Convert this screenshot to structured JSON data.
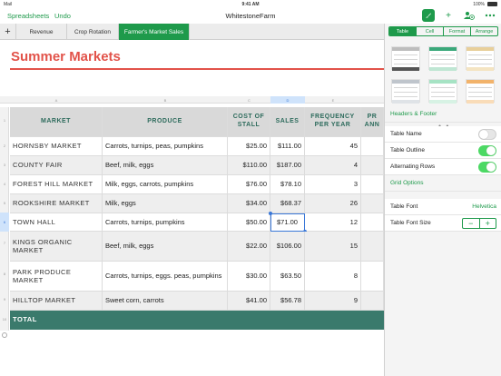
{
  "status_bar": {
    "carrier": "Mail",
    "wifi_icon": "wifi-icon",
    "time": "9:41 AM",
    "battery_pct": "100%"
  },
  "toolbar": {
    "spreadsheets_label": "Spreadsheets",
    "undo_label": "Undo",
    "doc_title": "WhitestoneFarm",
    "icons": [
      "paintbrush-icon",
      "plus-icon",
      "collaborate-icon",
      "more-icon"
    ],
    "accent": "#1e9a4b"
  },
  "sheet_tabs": {
    "add_label": "+",
    "tabs": [
      {
        "label": "Revenue",
        "active": false
      },
      {
        "label": "Crop Rotation",
        "active": false
      },
      {
        "label": "Farmer's Market Sales",
        "active": true
      }
    ]
  },
  "sheet": {
    "title": "Summer Markets",
    "title_color": "#e2534a",
    "column_letters": [
      "A",
      "B",
      "C",
      "D",
      "E"
    ],
    "selected_column": "D",
    "row_numbers": [
      "1",
      "2",
      "3",
      "4",
      "5",
      "6",
      "7",
      "8",
      "9",
      "10"
    ],
    "selected_row": "6",
    "headers": [
      "MARKET",
      "PRODUCE",
      "COST OF STALL",
      "SALES",
      "FREQUENCY PER YEAR",
      "PR ANN"
    ],
    "rows": [
      {
        "market": "HORNSBY MARKET",
        "produce": "Carrots, turnips, peas, pumpkins",
        "cost": "$25.00",
        "sales": "$111.00",
        "freq": "45"
      },
      {
        "market": "COUNTY FAIR",
        "produce": "Beef, milk, eggs",
        "cost": "$110.00",
        "sales": "$187.00",
        "freq": "4"
      },
      {
        "market": "FOREST HILL MARKET",
        "produce": "Milk, eggs, carrots, pumpkins",
        "cost": "$76.00",
        "sales": "$78.10",
        "freq": "3"
      },
      {
        "market": "ROOKSHIRE MARKET",
        "produce": "Milk, eggs",
        "cost": "$34.00",
        "sales": "$68.37",
        "freq": "26"
      },
      {
        "market": "TOWN HALL",
        "produce": "Carrots, turnips, pumpkins",
        "cost": "$50.00",
        "sales": "$71.00",
        "freq": "12"
      },
      {
        "market": "KINGS ORGANIC MARKET",
        "produce": "Beef, milk, eggs",
        "cost": "$22.00",
        "sales": "$106.00",
        "freq": "15"
      },
      {
        "market": "PARK PRODUCE MARKET",
        "produce": "Carrots, turnips, eggs. peas, pumpkins",
        "cost": "$30.00",
        "sales": "$63.50",
        "freq": "8"
      },
      {
        "market": "HILLTOP MARKET",
        "produce": "Sweet corn, carrots",
        "cost": "$41.00",
        "sales": "$56.78",
        "freq": "9"
      }
    ],
    "total_label": "TOTAL",
    "header_color": "#2d6b5c",
    "total_color": "#3a7a6c",
    "selection_color": "#3a78d8"
  },
  "format_panel": {
    "tabs": [
      {
        "label": "Table",
        "active": true
      },
      {
        "label": "Cell",
        "active": false
      },
      {
        "label": "Format",
        "active": false
      },
      {
        "label": "Arrange",
        "active": false
      }
    ],
    "table_styles": [
      "style-gray",
      "style-green",
      "style-tan",
      "style-slate",
      "style-mint",
      "style-orange"
    ],
    "headers_footer": "Headers & Footer",
    "table_name": {
      "label": "Table Name",
      "on": false
    },
    "table_outline": {
      "label": "Table Outline",
      "on": true
    },
    "alternating_rows": {
      "label": "Alternating Rows",
      "on": true
    },
    "grid_options": "Grid Options",
    "table_font": {
      "label": "Table Font",
      "value": "Helvetica"
    },
    "table_font_size": {
      "label": "Table Font Size",
      "decrease": "−",
      "increase": "+"
    }
  }
}
